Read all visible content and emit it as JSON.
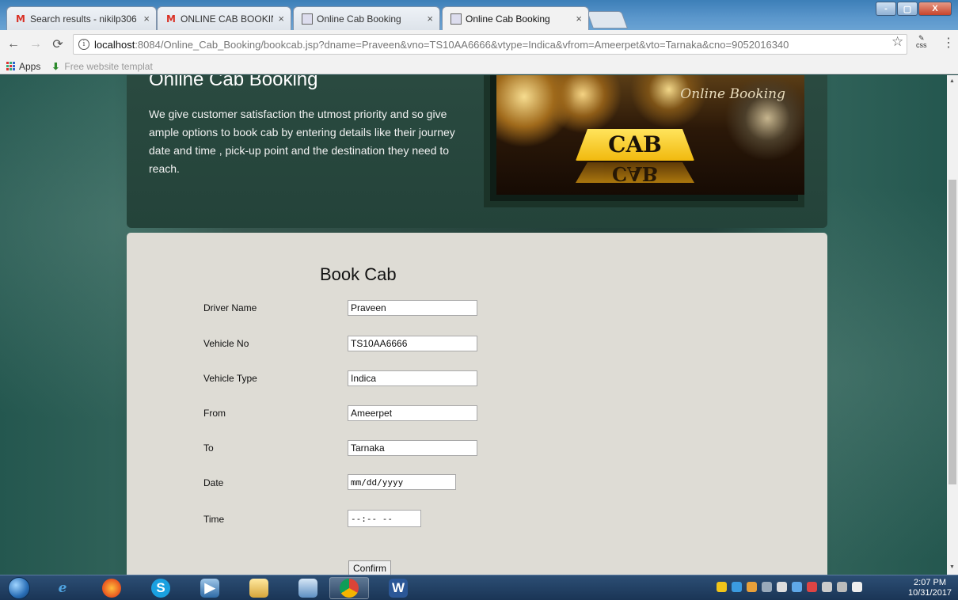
{
  "browser": {
    "tabs": [
      {
        "title": "Search results - nikilp306",
        "icon": "gmail-icon",
        "active": false
      },
      {
        "title": "ONLINE CAB BOOKING - ",
        "icon": "gmail-icon",
        "active": false
      },
      {
        "title": "Online Cab Booking",
        "icon": "image-icon",
        "active": false
      },
      {
        "title": "Online Cab Booking",
        "icon": "image-icon",
        "active": true
      }
    ],
    "tab_close_glyph": "×",
    "window_controls": [
      "-",
      "▢",
      "X"
    ],
    "url_host": "localhost",
    "url_rest": ":8084/Online_Cab_Booking/bookcab.jsp?dname=Praveen&vno=TS10AA6666&vtype=Indica&vfrom=Ameerpet&vto=Tarnaka&cno=9052016340",
    "ext_label": "css",
    "bookmarks": [
      {
        "label": "Apps",
        "icon": "apps-grid-icon"
      },
      {
        "label": "Free website templat",
        "icon": "download-arrow-icon"
      }
    ]
  },
  "hero": {
    "title": "Online Cab Booking",
    "description": "We give customer satisfaction the utmost priority and so give ample options to book cab by entering details like their journey date and time , pick-up point and the destination they need to reach.",
    "image_caption": "Online Booking",
    "image_sign": "CAB"
  },
  "form": {
    "title": "Book Cab",
    "rows": [
      {
        "label": "Driver Name",
        "value": "Praveen"
      },
      {
        "label": "Vehicle No",
        "value": "TS10AA6666"
      },
      {
        "label": "Vehicle Type",
        "value": "Indica"
      },
      {
        "label": "From",
        "value": "Ameerpet"
      },
      {
        "label": "To",
        "value": "Tarnaka"
      },
      {
        "label": "Date",
        "value": "mm/dd/yyyy"
      },
      {
        "label": "Time",
        "value": "--:-- --"
      }
    ],
    "confirm_label": "Confirm"
  },
  "taskbar": {
    "apps": [
      "start-orb",
      "internet-explorer-icon",
      "firefox-icon",
      "skype-icon",
      "media-player-icon",
      "file-explorer-icon",
      "virtualbox-icon",
      "chrome-icon",
      "word-icon"
    ],
    "time": "2:07 PM",
    "date": "10/31/2017"
  },
  "colors": {
    "panel": "#dedcd5",
    "hero": "#2a4a40",
    "page_bg": "#1f4a4a",
    "sign_yellow": "#f1b90e"
  }
}
